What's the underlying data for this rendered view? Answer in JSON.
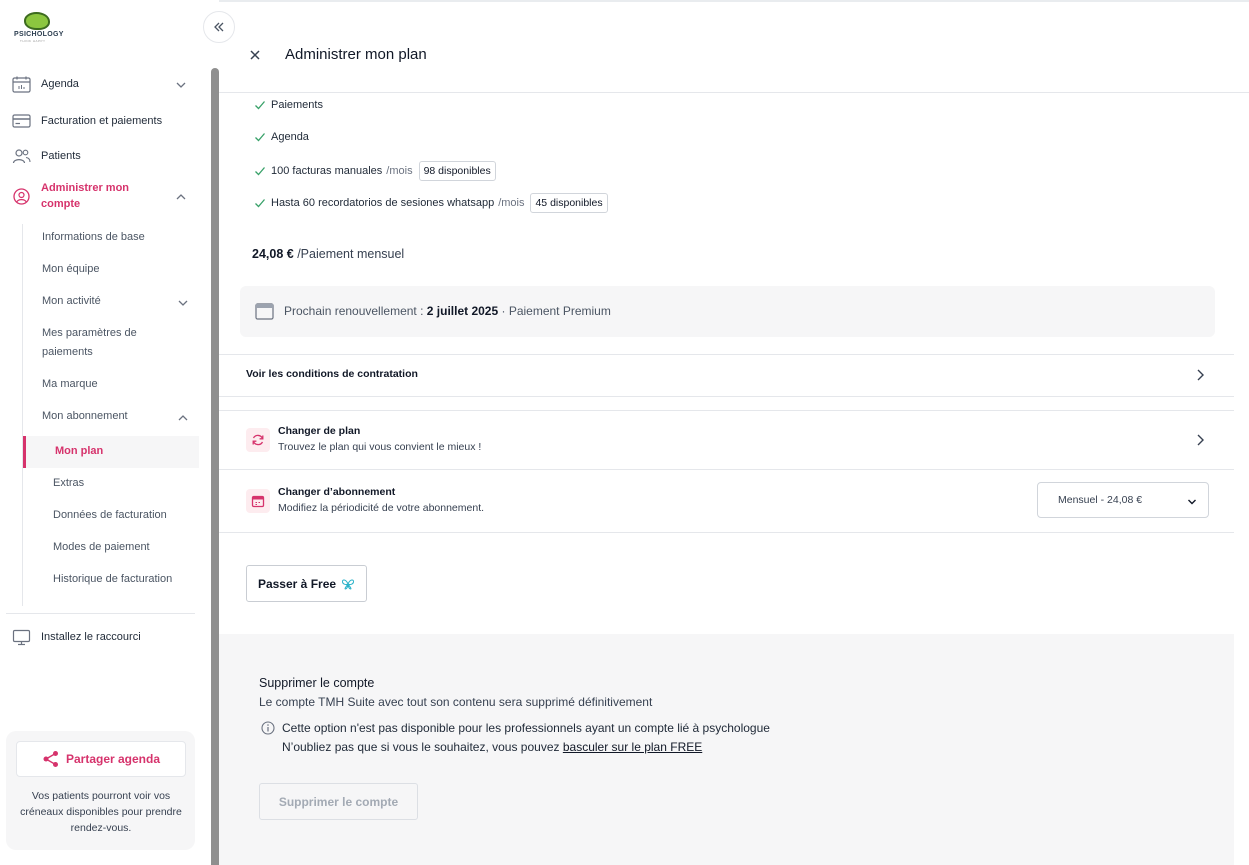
{
  "brand": {
    "logo_text": "PSICHOLOGY",
    "logo_tagline": "THINK HAPPY",
    "accent": "#d6336c"
  },
  "sidebar": {
    "items": [
      {
        "label": "Agenda",
        "icon": "calendar-icon"
      },
      {
        "label": "Facturation et paiements",
        "icon": "credit-card-icon"
      },
      {
        "label": "Patients",
        "icon": "users-icon"
      },
      {
        "label": "Administrer mon compte",
        "icon": "user-circle-icon"
      }
    ],
    "account_sub": [
      "Informations de base",
      "Mon équipe",
      "Mon activité",
      "Mes paramètres de paiements",
      "Ma marque",
      "Mon abonnement"
    ],
    "subscription_sub": [
      "Mon plan",
      "Extras",
      "Données de facturation",
      "Modes de paiement",
      "Historique de facturation"
    ],
    "install_label": "Installez le raccourci",
    "share": {
      "button": "Partager agenda",
      "description": "Vos patients pourront voir vos créneaux disponibles pour prendre rendez-vous."
    }
  },
  "main": {
    "title": "Administrer mon plan",
    "features": [
      {
        "label": "Paiements"
      },
      {
        "label": "Agenda"
      },
      {
        "label": "100 facturas manuales",
        "unit": "/mois",
        "badge": "98 disponibles"
      },
      {
        "label": "Hasta 60 recordatorios de sesiones whatsapp",
        "unit": "/mois",
        "badge": "45 disponibles"
      }
    ],
    "price": {
      "amount": "24,08 €",
      "period": "/Paiement mensuel"
    },
    "renewal": {
      "prefix": "Prochain renouvellement :",
      "date": "2 juillet 2025",
      "suffix": "· Paiement Premium"
    },
    "conditions_link": "Voir les conditions de contratation",
    "change_plan": {
      "title": "Changer de plan",
      "subtitle": "Trouvez le plan qui vous convient le mieux !"
    },
    "change_subscription": {
      "title": "Changer d’abonnement",
      "subtitle": "Modifiez la périodicité de votre abonnement.",
      "selected": "Mensuel - 24,08 €"
    },
    "free_button": {
      "prefix": "Passer à",
      "plan": "Free"
    },
    "delete": {
      "title": "Supprimer le compte",
      "description": "Le compte TMH Suite avec tout son contenu sera supprimé définitivement",
      "info_line1": "Cette option n'est pas disponible pour les professionnels ayant un compte lié à psychologue",
      "info_line2_prefix": "N’oubliez pas que si vous le souhaitez, vous pouvez",
      "info_line2_link": "basculer sur le plan FREE",
      "button": "Supprimer le compte"
    }
  }
}
